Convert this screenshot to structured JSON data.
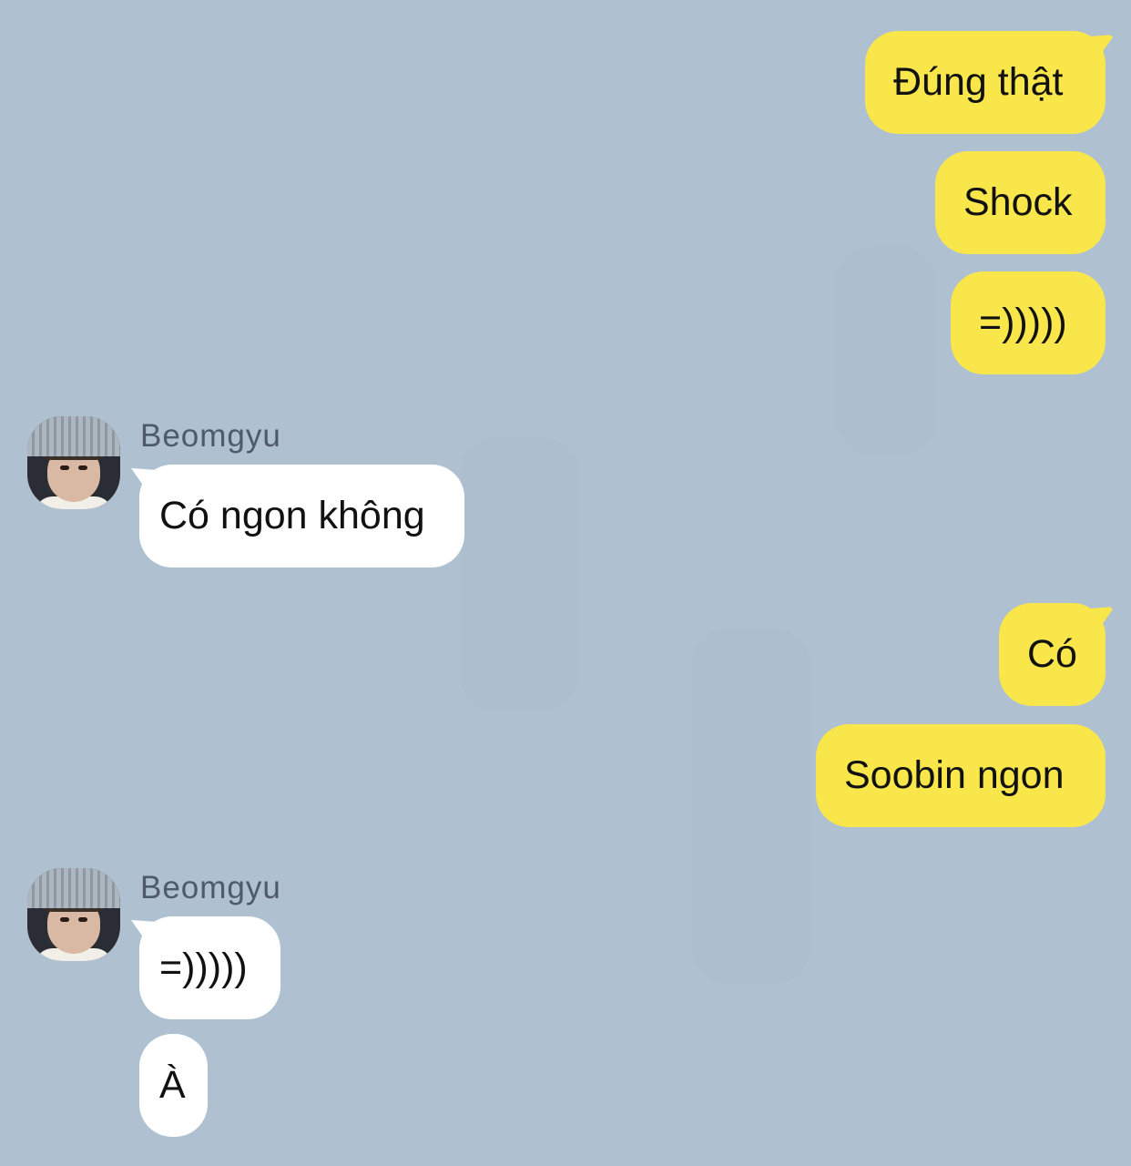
{
  "colors": {
    "background": "#afc1d1",
    "my_bubble": "#f8e64b",
    "their_bubble": "#ffffff",
    "sender_name": "#4e5a67"
  },
  "messages": [
    {
      "side": "mine",
      "text": "Đúng thật"
    },
    {
      "side": "mine",
      "text": "Shock"
    },
    {
      "side": "mine",
      "text": "=)))))"
    },
    {
      "side": "theirs",
      "sender": "Beomgyu",
      "text": "Có ngon không"
    },
    {
      "side": "mine",
      "text": "Có"
    },
    {
      "side": "mine",
      "text": "Soobin ngon"
    },
    {
      "side": "theirs",
      "sender": "Beomgyu",
      "text": "=)))))"
    },
    {
      "side": "theirs",
      "text": "À"
    }
  ],
  "groups": [
    {
      "sender": "Beomgyu",
      "avatar_icon": "user-avatar-photo"
    },
    {
      "sender": "Beomgyu",
      "avatar_icon": "user-avatar-photo"
    }
  ]
}
